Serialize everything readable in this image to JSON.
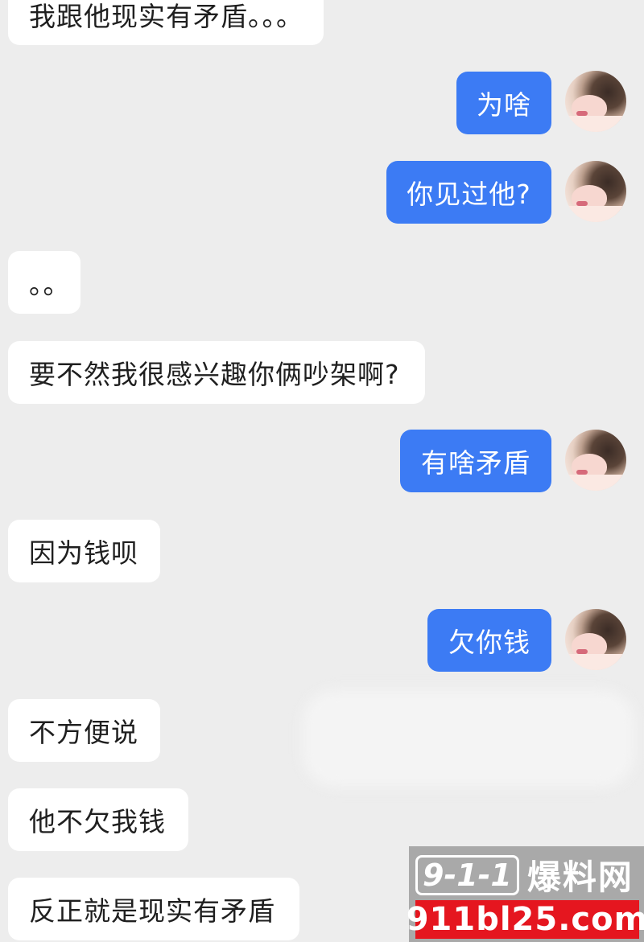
{
  "messages": [
    {
      "side": "in",
      "text": "我跟他现实有矛盾。。。"
    },
    {
      "side": "out",
      "text": "为啥"
    },
    {
      "side": "out",
      "text": "你见过他?"
    },
    {
      "side": "in",
      "text": "。。"
    },
    {
      "side": "in",
      "text": "要不然我很感兴趣你俩吵架啊?"
    },
    {
      "side": "out",
      "text": "有啥矛盾"
    },
    {
      "side": "in",
      "text": "因为钱呗"
    },
    {
      "side": "out",
      "text": "欠你钱"
    },
    {
      "side": "in",
      "text": "不方便说"
    },
    {
      "side": "in",
      "text": "他不欠我钱"
    },
    {
      "side": "in",
      "text": "反正就是现实有矛盾"
    }
  ],
  "watermark": {
    "logo": "9-1-1",
    "name": "爆料网",
    "site": "911bl25.com"
  },
  "colors": {
    "background": "#ededed",
    "incoming_bubble": "#ffffff",
    "outgoing_bubble": "#3c7bf4",
    "watermark_red": "#e5161f"
  },
  "icons": {
    "avatar": "user-avatar-photo"
  }
}
